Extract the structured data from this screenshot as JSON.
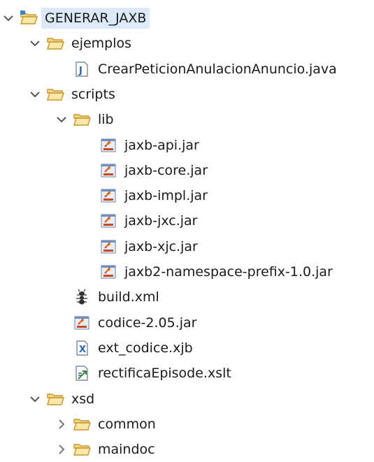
{
  "tree": [
    {
      "label": "GENERAR_JAXB",
      "icon": "project-folder-icon",
      "depth": 0,
      "expanded": true,
      "selected": true
    },
    {
      "label": "ejemplos",
      "icon": "folder-icon",
      "depth": 1,
      "expanded": true
    },
    {
      "label": "CrearPeticionAnulacionAnuncio.java",
      "icon": "java-file-icon",
      "depth": 2
    },
    {
      "label": "scripts",
      "icon": "folder-icon",
      "depth": 1,
      "expanded": true
    },
    {
      "label": "lib",
      "icon": "folder-icon",
      "depth": 2,
      "expanded": true
    },
    {
      "label": "jaxb-api.jar",
      "icon": "jar-file-icon",
      "depth": 3
    },
    {
      "label": "jaxb-core.jar",
      "icon": "jar-file-icon",
      "depth": 3
    },
    {
      "label": "jaxb-impl.jar",
      "icon": "jar-file-icon",
      "depth": 3
    },
    {
      "label": "jaxb-jxc.jar",
      "icon": "jar-file-icon",
      "depth": 3
    },
    {
      "label": "jaxb-xjc.jar",
      "icon": "jar-file-icon",
      "depth": 3
    },
    {
      "label": "jaxb2-namespace-prefix-1.0.jar",
      "icon": "jar-file-icon",
      "depth": 3
    },
    {
      "label": "build.xml",
      "icon": "ant-file-icon",
      "depth": 2
    },
    {
      "label": "codice-2.05.jar",
      "icon": "jar-file-icon",
      "depth": 2
    },
    {
      "label": "ext_codice.xjb",
      "icon": "xjb-file-icon",
      "depth": 2
    },
    {
      "label": "rectificaEpisode.xslt",
      "icon": "xslt-file-icon",
      "depth": 2
    },
    {
      "label": "xsd",
      "icon": "folder-icon",
      "depth": 1,
      "expanded": true
    },
    {
      "label": "common",
      "icon": "folder-icon",
      "depth": 2,
      "expanded": false
    },
    {
      "label": "maindoc",
      "icon": "folder-icon",
      "depth": 2,
      "expanded": false
    }
  ],
  "colors": {
    "selection": "#dbe9f8",
    "folder_fill": "#fbe7a6",
    "folder_stroke": "#c8962e",
    "chevron": "#555555"
  }
}
